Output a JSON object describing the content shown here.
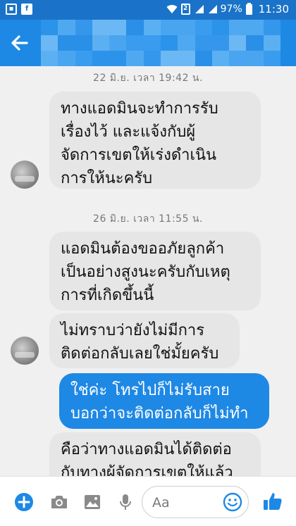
{
  "status_bar": {
    "battery": "97%",
    "time": "11:30",
    "sim_label": "2"
  },
  "header": {
    "contact_name_hidden": true
  },
  "messages": [
    {
      "type": "timestamp",
      "text": "22 มิ.ย. เวลา 19:42 น."
    },
    {
      "type": "incoming",
      "lines": [
        "ทางแอดมินจะทำการรับ",
        "เรื่องไว้ และแจ้งกับผู้",
        "จัดการเขตให้เร่งดำเนิน",
        "การให้นะครับ"
      ]
    },
    {
      "type": "timestamp",
      "text": "26 มิ.ย. เวลา 11:55 น."
    },
    {
      "type": "incoming",
      "lines": [
        "แอดมินต้องขออภัยลูกค้า",
        "เป็นอย่างสูงนะครับกับเหตุ",
        "การที่เกิดขึ้นนี้"
      ]
    },
    {
      "type": "incoming",
      "lines": [
        "ไม่ทราบว่ายังไม่มีการ",
        "ติดต่อกลับเลยใช่มั้ยครับ"
      ]
    },
    {
      "type": "outgoing",
      "lines": [
        "ใช่ค่ะ โทรไปก็ไม่รับสาย",
        "บอกว่าจะติดต่อกลับก็ไม่ทำ"
      ]
    },
    {
      "type": "incoming",
      "lines": [
        "คือว่าทางแอดมินได้ติดต่อ",
        "กับทางผู้จัดการเขตให้แล้ว"
      ]
    }
  ],
  "composer": {
    "placeholder": "Aa"
  },
  "icons": {
    "add": "plus-circle-icon",
    "camera": "camera-icon",
    "gallery": "image-icon",
    "voice": "microphone-icon",
    "emoji": "smiley-icon",
    "like": "thumbs-up-icon"
  },
  "colors": {
    "status_bar": "#1a73c8",
    "header": "#1e88e5",
    "outgoing_bubble": "#1e88e5",
    "incoming_bubble": "#e6e6e6",
    "chat_bg": "#f0f0f0",
    "icon_gray": "#8a8a8a"
  }
}
